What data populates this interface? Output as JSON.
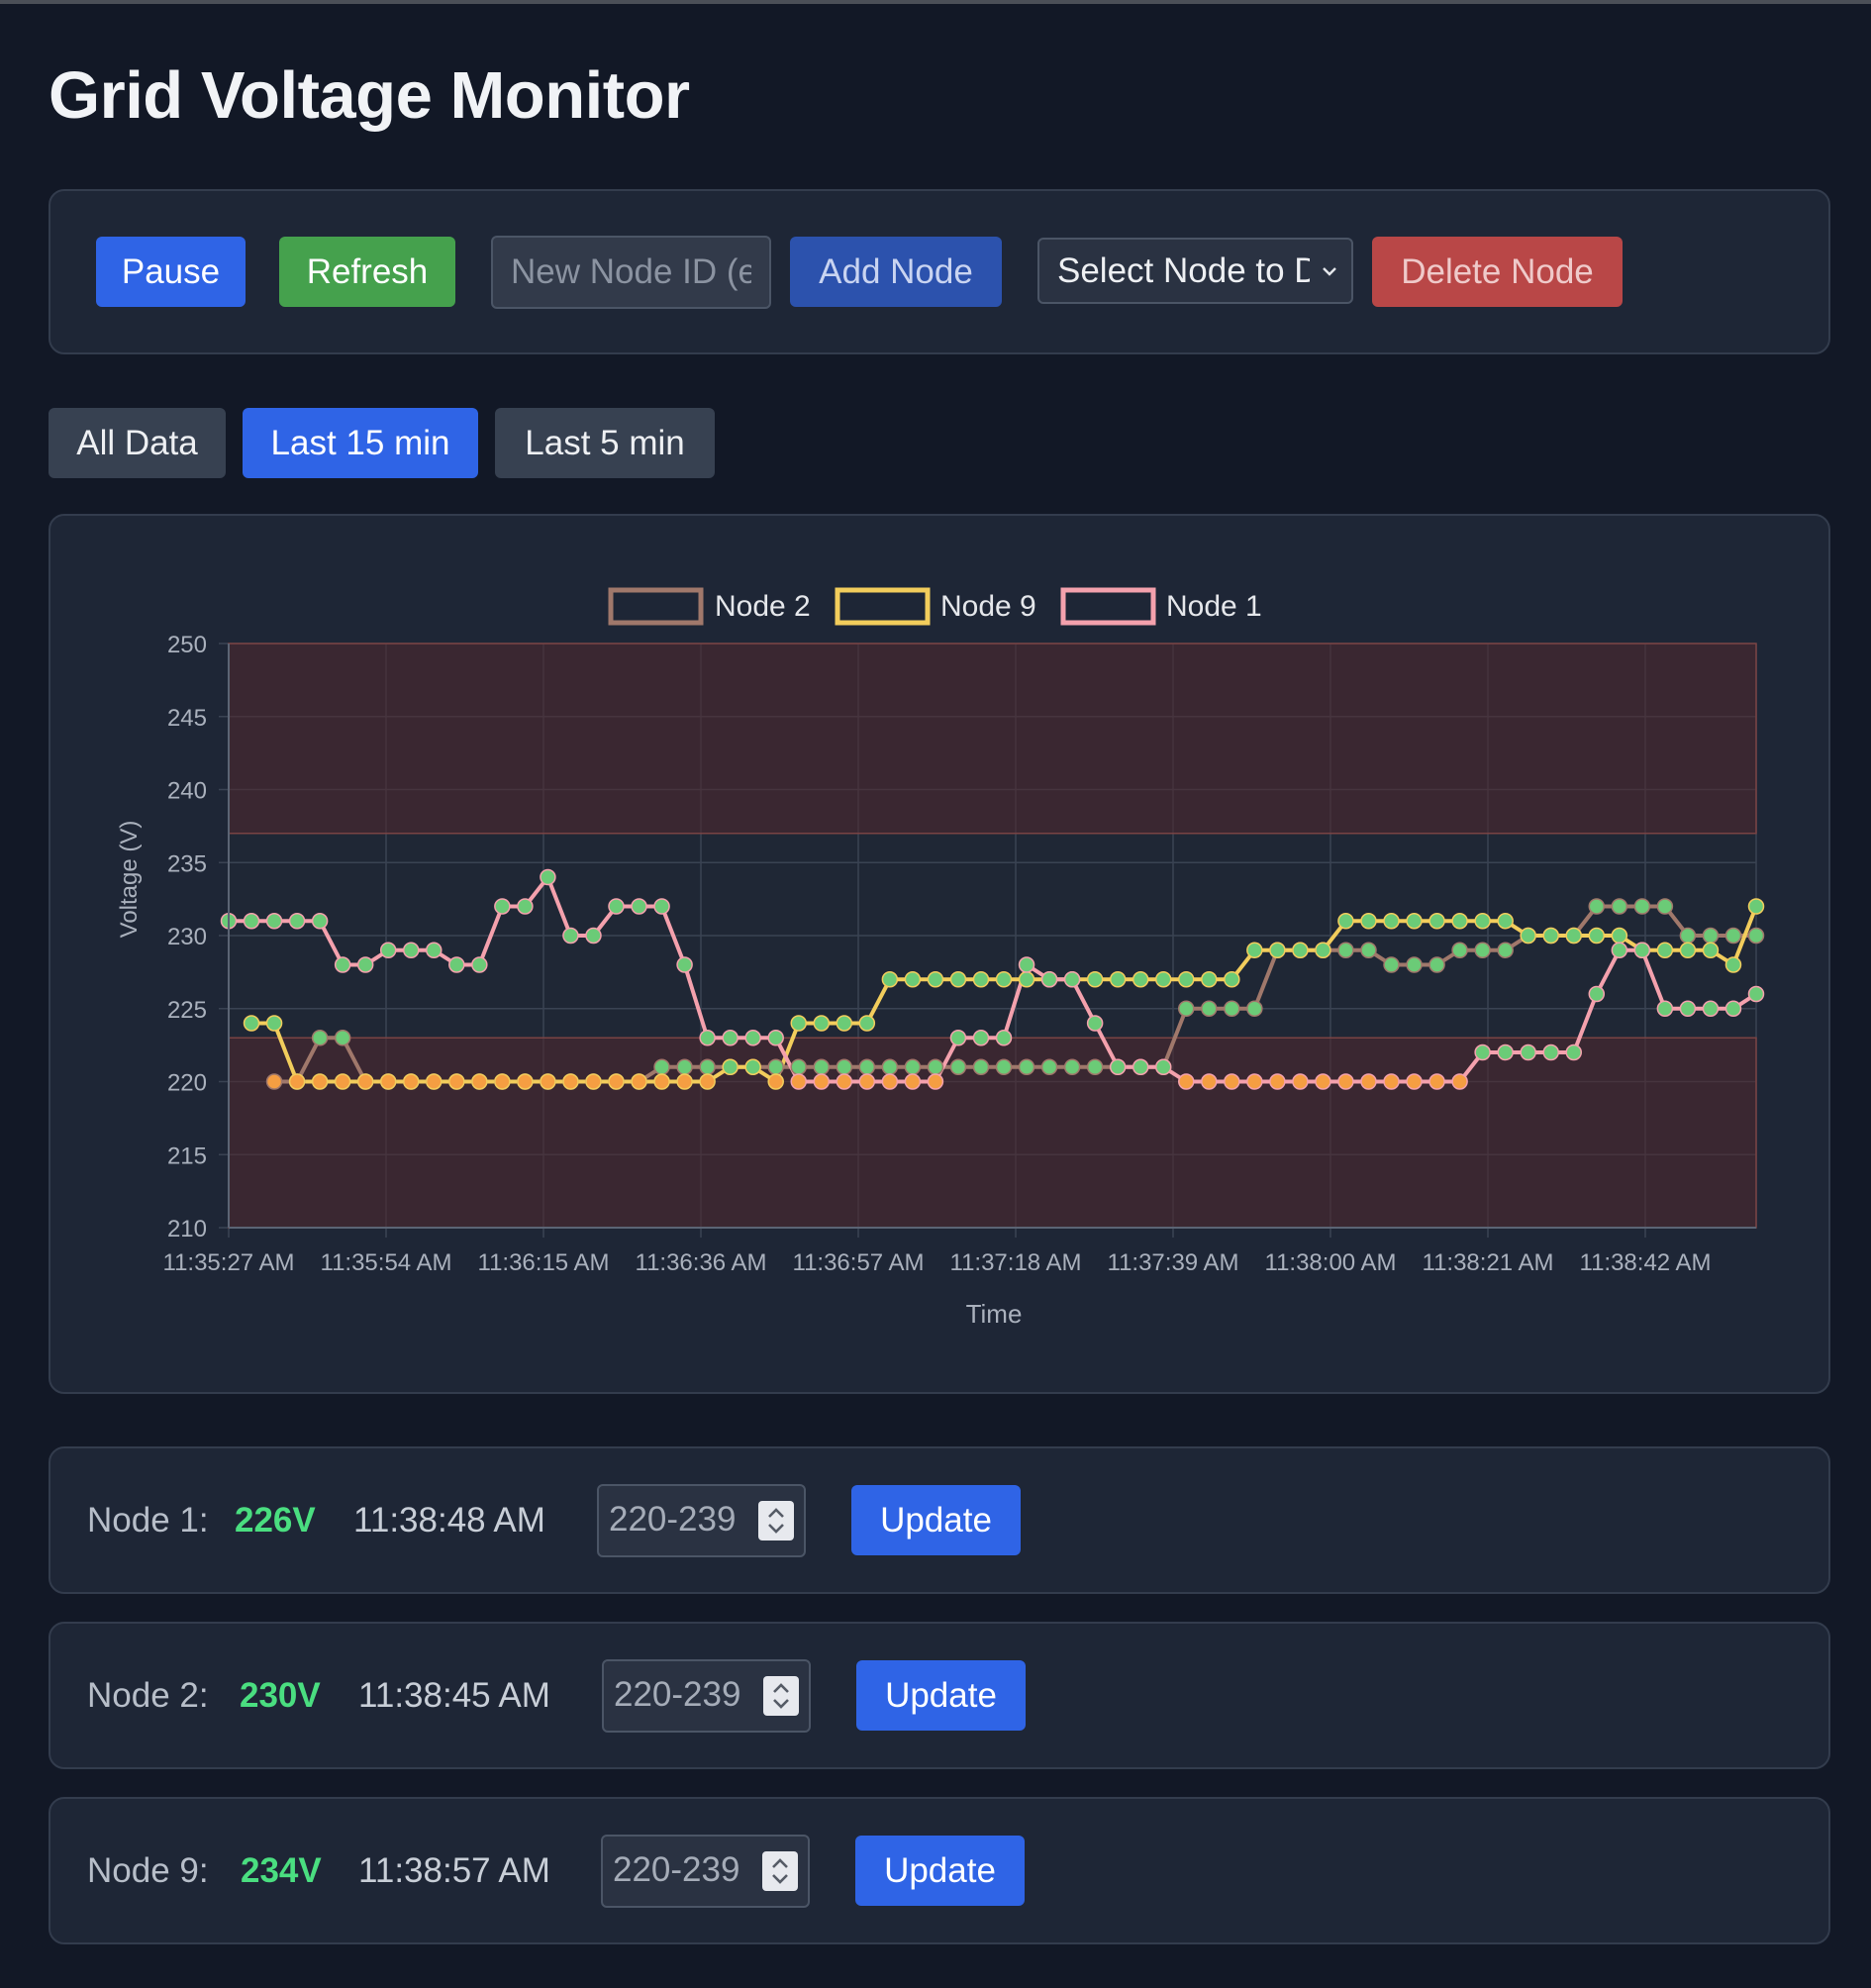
{
  "page_title": "Grid Voltage Monitor",
  "controls": {
    "pause_label": "Pause",
    "refresh_label": "Refresh",
    "new_node_placeholder": "New Node ID (e",
    "add_node_label": "Add Node",
    "select_node_label": "Select Node to D",
    "delete_node_label": "Delete Node"
  },
  "range_tabs": [
    {
      "label": "All Data",
      "active": false
    },
    {
      "label": "Last 15 min",
      "active": true
    },
    {
      "label": "Last 5 min",
      "active": false
    }
  ],
  "colors": {
    "accent": "#2f64e6",
    "success": "#45a14d",
    "danger": "#b94747",
    "voltage_ok": "#4ade80",
    "node2": "#a0786b",
    "node9": "#f2cd5c",
    "node1": "#f4a1ad",
    "point_ok": "#6bcb77",
    "point_low": "#f59e42"
  },
  "chart_data": {
    "type": "line",
    "ylabel": "Voltage (V)",
    "xlabel": "Time",
    "ylim": [
      210,
      250
    ],
    "yticks": [
      250,
      245,
      240,
      235,
      230,
      225,
      220,
      215,
      210
    ],
    "x_tick_labels": [
      "11:35:27 AM",
      "11:35:54 AM",
      "11:36:15 AM",
      "11:36:36 AM",
      "11:36:57 AM",
      "11:37:18 AM",
      "11:37:39 AM",
      "11:38:00 AM",
      "11:38:21 AM",
      "11:38:42 AM"
    ],
    "grid": true,
    "legend_position": "top-center",
    "safe_range": [
      223,
      237
    ],
    "series": [
      {
        "name": "Node 2",
        "color": "#a0786b",
        "values": [
          null,
          null,
          220,
          220,
          223,
          223,
          220,
          220,
          220,
          220,
          220,
          220,
          220,
          220,
          220,
          220,
          220,
          220,
          220,
          221,
          221,
          221,
          221,
          221,
          221,
          221,
          221,
          221,
          221,
          221,
          221,
          221,
          221,
          221,
          221,
          221,
          221,
          221,
          221,
          221,
          221,
          221,
          225,
          225,
          225,
          225,
          229,
          229,
          229,
          229,
          229,
          228,
          228,
          228,
          229,
          229,
          229,
          230,
          230,
          230,
          232,
          232,
          232,
          232,
          230,
          230,
          230,
          230
        ]
      },
      {
        "name": "Node 9",
        "color": "#f2cd5c",
        "values": [
          null,
          224,
          224,
          220,
          220,
          220,
          220,
          220,
          220,
          220,
          220,
          220,
          220,
          220,
          220,
          220,
          220,
          220,
          220,
          220,
          220,
          220,
          221,
          221,
          220,
          224,
          224,
          224,
          224,
          227,
          227,
          227,
          227,
          227,
          227,
          227,
          227,
          227,
          227,
          227,
          227,
          227,
          227,
          227,
          227,
          229,
          229,
          229,
          229,
          231,
          231,
          231,
          231,
          231,
          231,
          231,
          231,
          230,
          230,
          230,
          230,
          230,
          229,
          229,
          229,
          229,
          228,
          232,
          234
        ]
      },
      {
        "name": "Node 1",
        "color": "#f4a1ad",
        "values": [
          231,
          231,
          231,
          231,
          231,
          228,
          228,
          229,
          229,
          229,
          228,
          228,
          232,
          232,
          234,
          230,
          230,
          232,
          232,
          232,
          228,
          223,
          223,
          223,
          223,
          220,
          220,
          220,
          220,
          220,
          220,
          220,
          223,
          223,
          223,
          228,
          227,
          227,
          224,
          221,
          221,
          221,
          220,
          220,
          220,
          220,
          220,
          220,
          220,
          220,
          220,
          220,
          220,
          220,
          220,
          222,
          222,
          222,
          222,
          222,
          226,
          229,
          229,
          225,
          225,
          225,
          225,
          226,
          226,
          226,
          226
        ]
      }
    ]
  },
  "nodes": [
    {
      "label": "Node 1:",
      "voltage": "226V",
      "time": "11:38:48 AM",
      "range": "220-239",
      "update_label": "Update"
    },
    {
      "label": "Node 2:",
      "voltage": "230V",
      "time": "11:38:45 AM",
      "range": "220-239",
      "update_label": "Update"
    },
    {
      "label": "Node 9:",
      "voltage": "234V",
      "time": "11:38:57 AM",
      "range": "220-239",
      "update_label": "Update"
    }
  ]
}
